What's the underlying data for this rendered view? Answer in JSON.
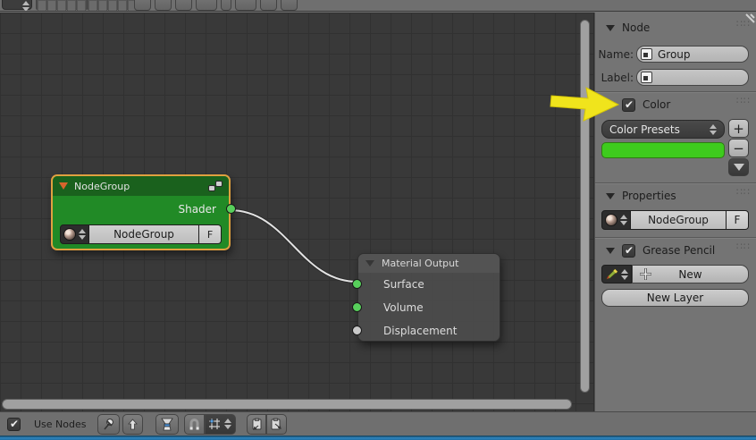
{
  "colors": {
    "node_header_green": "#1a611d",
    "node_body_green": "#218a26",
    "selection_orange": "#dfa040",
    "swatch_green": "#3ecb1d",
    "arrow_yellow": "#f0e41c",
    "blue_strip": "#2e84bd",
    "canvas_bg": "#393939",
    "sidebar_bg": "#747474"
  },
  "top_bar": {
    "icons": [
      "layers-grid-icon",
      "layers-grid-icon",
      "node-insert-icon",
      "background-icon",
      "render-icon",
      "view-axis-icon",
      "snap-icon",
      "camera-icon",
      "clipboard-icon"
    ]
  },
  "canvas": {
    "nodegroup": {
      "title": "NodeGroup",
      "output_label": "Shader",
      "name_value": "NodeGroup",
      "fake_user_label": "F"
    },
    "material_output": {
      "title": "Material Output",
      "inputs": [
        {
          "label": "Surface",
          "socket_color": "#57cf5b"
        },
        {
          "label": "Volume",
          "socket_color": "#57cf5b"
        },
        {
          "label": "Displacement",
          "socket_color": "#c9c9c9"
        }
      ]
    }
  },
  "sidebar": {
    "node_panel": {
      "title": "Node",
      "name_label": "Name:",
      "name_value": "Group",
      "label_label": "Label:",
      "label_value": ""
    },
    "color_panel": {
      "title": "Color",
      "checked": true,
      "presets_label": "Color Presets",
      "add_label": "+",
      "remove_label": "−"
    },
    "properties_panel": {
      "title": "Properties",
      "id_value": "NodeGroup",
      "fake_user_label": "F"
    },
    "grease_pencil_panel": {
      "title": "Grease Pencil",
      "checked": true,
      "new_label": "New",
      "new_layer_label": "New Layer"
    }
  },
  "bottom_bar": {
    "use_nodes_label": "Use Nodes",
    "use_nodes_checked": true,
    "icons": [
      "pin-icon",
      "parent-up-icon",
      "material-node-icon",
      "magnet-icon",
      "snap-grid-icon",
      "copy-icon",
      "paste-icon"
    ]
  }
}
